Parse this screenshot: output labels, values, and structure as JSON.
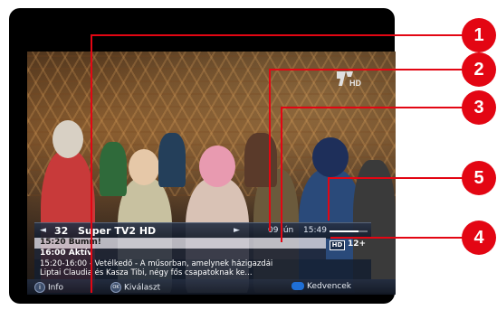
{
  "channel_logo": {
    "text": "HD",
    "icon": "super-tv2-logo"
  },
  "osd": {
    "channel_number": "32",
    "channel_name": "Super TV2 HD",
    "date": "09 jún",
    "time": "15:49",
    "current_program": "15:20 Bumm!",
    "next_program": "16:00 Aktív",
    "badge_hd": "HD",
    "age_rating": "12+",
    "progress": 0.75,
    "description_line1": "15:20-16:00 - Vetélkedő - A műsorban, amelynek házigazdái",
    "description_line2": "Liptai Claudia és Kasza Tibi, négy fős csapatoknak ke...",
    "buttons": {
      "info_label": "Info",
      "info_icon_text": "i",
      "select_label": "Kiválaszt",
      "select_icon_text": "OK",
      "favorites_label": "Kedvencek"
    }
  },
  "callouts": [
    "1",
    "2",
    "3",
    "5",
    "4"
  ],
  "colors": {
    "callout": "#e30613",
    "favorites_button": "#1f6fd6"
  }
}
